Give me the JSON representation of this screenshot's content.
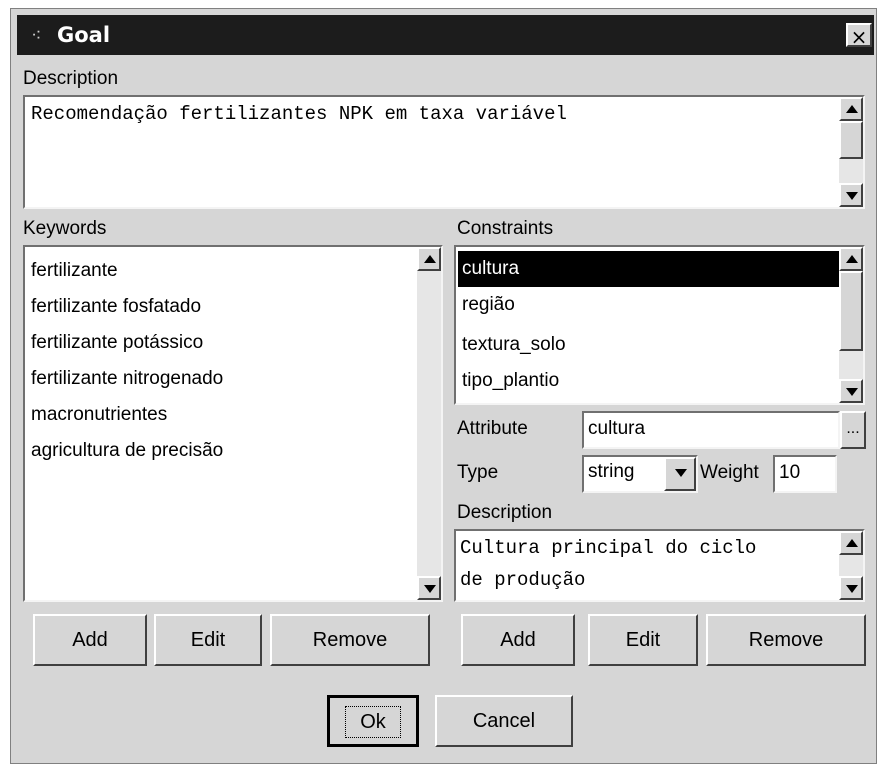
{
  "window": {
    "title": "Goal",
    "close_glyph": "×",
    "icon": "window-icon"
  },
  "description": {
    "label": "Description",
    "text": "Recomendação fertilizantes NPK em taxa variável"
  },
  "keywords": {
    "label": "Keywords",
    "items": [
      "fertilizante",
      "fertilizante fosfatado",
      "fertilizante potássico",
      "fertilizante nitrogenado",
      "macronutrientes",
      "agricultura de precisão"
    ],
    "buttons": {
      "add": "Add",
      "edit": "Edit",
      "remove": "Remove"
    }
  },
  "constraints": {
    "label": "Constraints",
    "items": [
      "cultura",
      "região",
      "textura_solo",
      "tipo_plantio"
    ],
    "selected_index": 0,
    "attribute_label": "Attribute",
    "attribute_value": "cultura",
    "browse_label": "...",
    "type_label": "Type",
    "type_value": "string",
    "weight_label": "Weight",
    "weight_value": "10",
    "description_label": "Description",
    "description_line1": "Cultura principal do ciclo",
    "description_line2": "de produção",
    "buttons": {
      "add": "Add",
      "edit": "Edit",
      "remove": "Remove"
    }
  },
  "footer": {
    "ok": "Ok",
    "cancel": "Cancel"
  },
  "colors": {
    "titlebar": "#1c1c1c",
    "dialog": "#d6d6d6",
    "selection": "#000000"
  }
}
